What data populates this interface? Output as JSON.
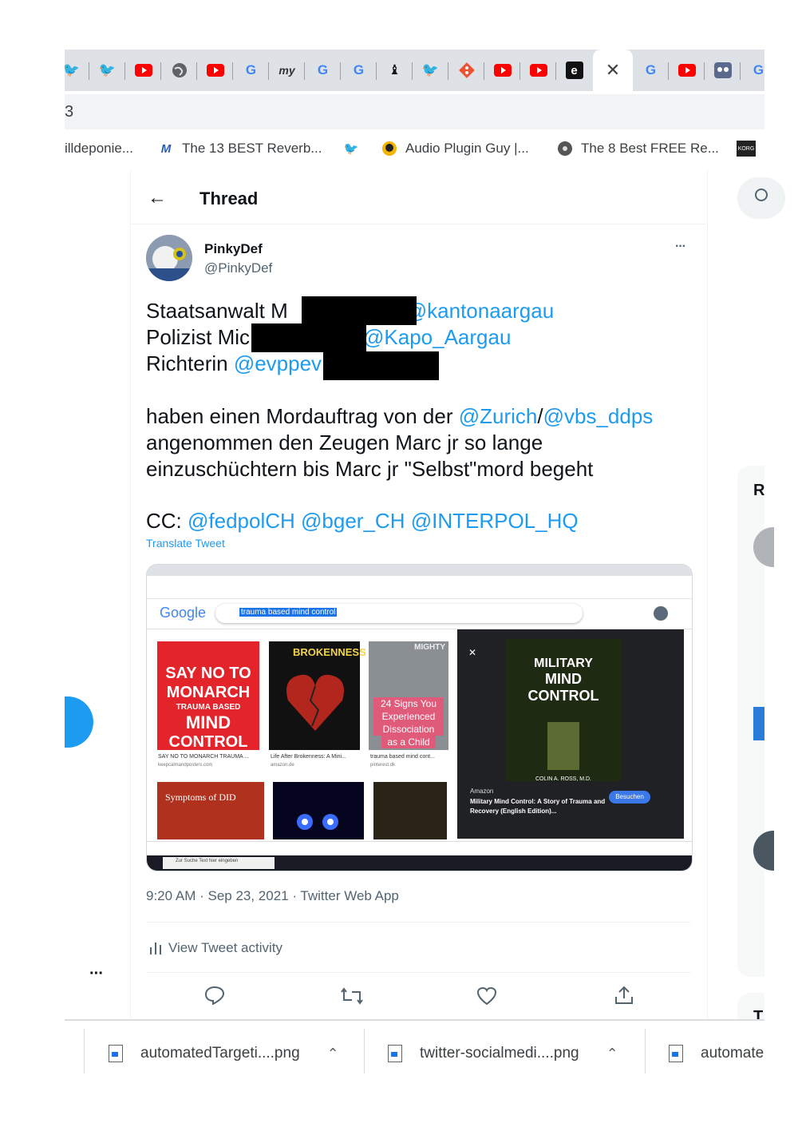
{
  "url_fragment": "3",
  "bookmarks": [
    {
      "label": "illdeponie...",
      "icon": ""
    },
    {
      "label": "The 13 BEST Reverb...",
      "icon": "mixed-logo-icon"
    },
    {
      "label": "",
      "icon": "twitter-icon"
    },
    {
      "label": "Audio Plugin Guy |...",
      "icon": "plugin-guy-icon"
    },
    {
      "label": "The 8 Best FREE Re...",
      "icon": "record-icon"
    }
  ],
  "thread": {
    "title": "Thread",
    "author_name": "PinkyDef",
    "author_handle": "@PinkyDef",
    "line1_prefix": "Staatsanwalt M",
    "line1_mention": "@kantonaargau",
    "line2_prefix": "Polizist Mic",
    "line2_mention": "@Kapo_Aargau",
    "line3_prefix": "Richterin ",
    "line3_mention": "@evppev",
    "p2_a": "haben einen Mordauftrag von der ",
    "p2_mention1": "@Zurich",
    "p2_slash": "/",
    "p2_mention2": "@vbs_ddps",
    "p2_line2": "angenommen den Zeugen Marc jr so lange",
    "p2_line3": "einzuschüchtern bis Marc jr \"Selbst\"mord begeht",
    "cc_prefix": "CC: ",
    "cc_m1": "@fedpolCH",
    "cc_m2": "@bger_CH",
    "cc_m3": "@INTERPOL_HQ",
    "translate": "Translate Tweet",
    "timestamp": "9:20 AM · Sep 23, 2021 · Twitter Web App",
    "activity": "View Tweet activity",
    "more": "···"
  },
  "screenshot": {
    "search_query": "trauma based mind control",
    "google": "Google",
    "tile1_lines": [
      "SAY NO TO",
      "MONARCH",
      "TRAUMA BASED",
      "MIND",
      "CONTROL"
    ],
    "tile1_caption": "SAY NO TO MONARCH TRAUMA ...",
    "tile1_source": "keepcalmandposters.com",
    "tile2_title": "BROKENNESS",
    "tile2_caption": "Life After Brokenness: A Mini...",
    "tile2_source": "amazon.de",
    "tile3_top": "MIGHTY",
    "tile3_lines": [
      "24 Signs You",
      "Experienced",
      "Dissociation",
      "as a Child"
    ],
    "tile3_caption": "trauma based mind cont...",
    "tile3_source": "pinterest.dk",
    "panel_title_lines": [
      "MILITARY",
      "MIND",
      "CONTROL"
    ],
    "panel_author": "COLIN A. ROSS, M.D.",
    "panel_source": "Amazon",
    "panel_button": "Besuchen",
    "panel_desc": "Military Mind Control: A Story of Trauma and Recovery (English Edition)...",
    "tile4_title": "Symptoms of DID",
    "taskbar_search": "Zur Suche Text hier eingeben"
  },
  "side": {
    "letter_r": "R",
    "letter_t": "T",
    "more": "···"
  },
  "downloads": [
    {
      "name": "automatedTargeti....png"
    },
    {
      "name": "twitter-socialmedi....png"
    },
    {
      "name": "automate"
    }
  ],
  "colors": {
    "twitter_blue": "#1d9bf0",
    "youtube_red": "#ff0000"
  }
}
